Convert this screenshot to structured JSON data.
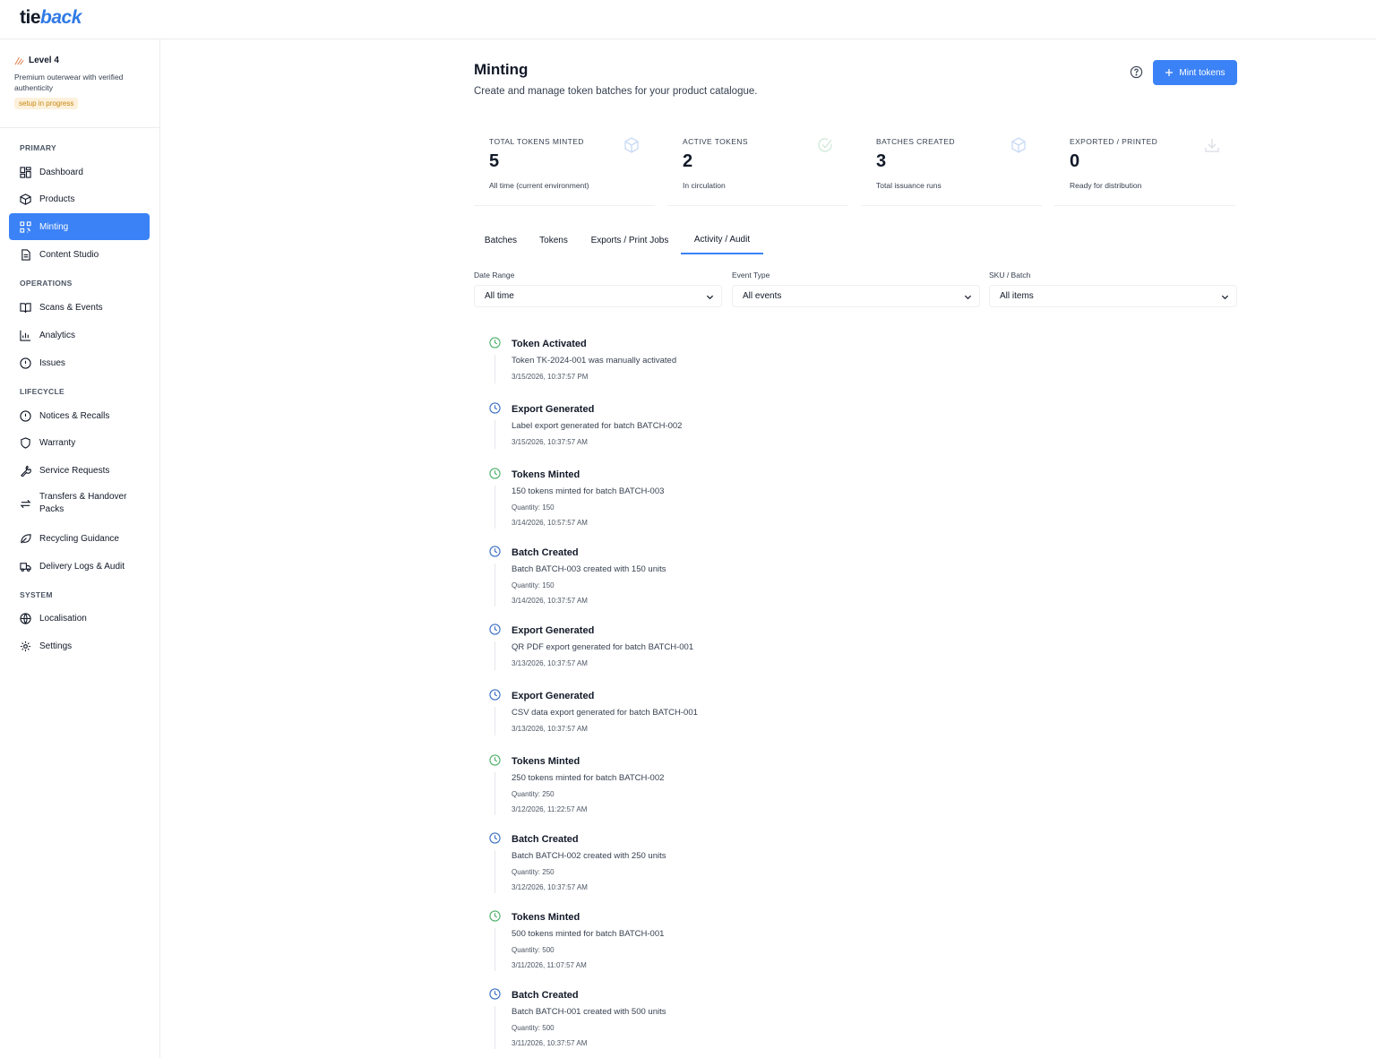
{
  "brand": {
    "tie": "tie",
    "back": "back"
  },
  "level": {
    "title": "Level 4",
    "description": "Premium outerwear with verified authenticity",
    "badge": "setup in progress"
  },
  "nav": {
    "sections": [
      "PRIMARY",
      "OPERATIONS",
      "LIFECYCLE",
      "SYSTEM"
    ],
    "items": [
      {
        "label": "Dashboard",
        "icon": "dashboard-icon"
      },
      {
        "label": "Products",
        "icon": "box-icon"
      },
      {
        "label": "Minting",
        "icon": "qr-icon",
        "active": true
      },
      {
        "label": "Content Studio",
        "icon": "document-icon"
      },
      {
        "label": "Scans & Events",
        "icon": "book-icon"
      },
      {
        "label": "Analytics",
        "icon": "bar-chart-icon"
      },
      {
        "label": "Issues",
        "icon": "alert-circle-icon"
      },
      {
        "label": "Notices & Recalls",
        "icon": "alert-circle-icon"
      },
      {
        "label": "Warranty",
        "icon": "shield-icon"
      },
      {
        "label": "Service Requests",
        "icon": "wrench-icon"
      },
      {
        "label": "Transfers & Handover Packs",
        "icon": "arrows-icon"
      },
      {
        "label": "Recycling Guidance",
        "icon": "leaf-icon"
      },
      {
        "label": "Delivery Logs & Audit",
        "icon": "truck-icon"
      },
      {
        "label": "Localisation",
        "icon": "globe-icon"
      },
      {
        "label": "Settings",
        "icon": "gear-icon"
      }
    ]
  },
  "header": {
    "title": "Minting",
    "subtitle": "Create and manage token batches for your product catalogue.",
    "mint_button": "Mint tokens"
  },
  "stats": [
    {
      "label": "TOTAL TOKENS MINTED",
      "value": "5",
      "note": "All time (current environment)",
      "icon": "cube-icon"
    },
    {
      "label": "ACTIVE TOKENS",
      "value": "2",
      "note": "In circulation",
      "icon": "check-circle-icon"
    },
    {
      "label": "BATCHES CREATED",
      "value": "3",
      "note": "Total issuance runs",
      "icon": "cube-icon"
    },
    {
      "label": "EXPORTED / PRINTED",
      "value": "0",
      "note": "Ready for distribution",
      "icon": "download-icon"
    }
  ],
  "tabs": [
    {
      "label": "Batches"
    },
    {
      "label": "Tokens"
    },
    {
      "label": "Exports / Print Jobs"
    },
    {
      "label": "Activity / Audit",
      "active": true
    }
  ],
  "filters": [
    {
      "label": "Date Range",
      "value": "All time"
    },
    {
      "label": "Event Type",
      "value": "All events"
    },
    {
      "label": "SKU / Batch",
      "value": "All items"
    }
  ],
  "colors": {
    "accent": "#3b82f6",
    "green": "#4caf6a",
    "blue_icon": "#3b6fc4"
  },
  "events": [
    {
      "title": "Token Activated",
      "description": "Token TK-2024-001 was manually activated",
      "quantity": "",
      "time": "3/15/2026, 10:37:57 PM",
      "color": "green"
    },
    {
      "title": "Export Generated",
      "description": "Label export generated for batch BATCH-002",
      "quantity": "",
      "time": "3/15/2026, 10:37:57 AM",
      "color": "blue"
    },
    {
      "title": "Tokens Minted",
      "description": "150 tokens minted for batch BATCH-003",
      "quantity": "Quantity: 150",
      "time": "3/14/2026, 10:57:57 AM",
      "color": "green"
    },
    {
      "title": "Batch Created",
      "description": "Batch BATCH-003 created with 150 units",
      "quantity": "Quantity: 150",
      "time": "3/14/2026, 10:37:57 AM",
      "color": "blue"
    },
    {
      "title": "Export Generated",
      "description": "QR PDF export generated for batch BATCH-001",
      "quantity": "",
      "time": "3/13/2026, 10:37:57 AM",
      "color": "blue"
    },
    {
      "title": "Export Generated",
      "description": "CSV data export generated for batch BATCH-001",
      "quantity": "",
      "time": "3/13/2026, 10:37:57 AM",
      "color": "blue"
    },
    {
      "title": "Tokens Minted",
      "description": "250 tokens minted for batch BATCH-002",
      "quantity": "Quantity: 250",
      "time": "3/12/2026, 11:22:57 AM",
      "color": "green"
    },
    {
      "title": "Batch Created",
      "description": "Batch BATCH-002 created with 250 units",
      "quantity": "Quantity: 250",
      "time": "3/12/2026, 10:37:57 AM",
      "color": "blue"
    },
    {
      "title": "Tokens Minted",
      "description": "500 tokens minted for batch BATCH-001",
      "quantity": "Quantity: 500",
      "time": "3/11/2026, 11:07:57 AM",
      "color": "green"
    },
    {
      "title": "Batch Created",
      "description": "Batch BATCH-001 created with 500 units",
      "quantity": "Quantity: 500",
      "time": "3/11/2026, 10:37:57 AM",
      "color": "blue"
    }
  ]
}
